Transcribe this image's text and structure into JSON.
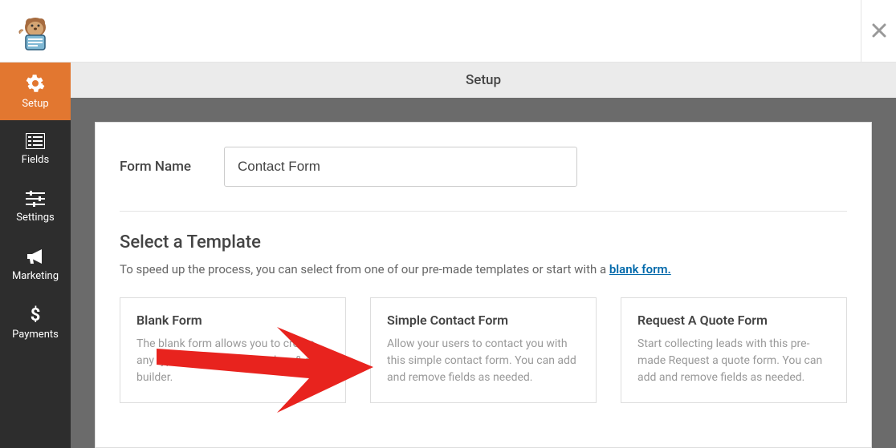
{
  "header": {
    "page_title": "Setup"
  },
  "sidebar": {
    "items": [
      {
        "label": "Setup",
        "icon": "gear"
      },
      {
        "label": "Fields",
        "icon": "list"
      },
      {
        "label": "Settings",
        "icon": "sliders"
      },
      {
        "label": "Marketing",
        "icon": "megaphone"
      },
      {
        "label": "Payments",
        "icon": "dollar"
      }
    ]
  },
  "form_name": {
    "label": "Form Name",
    "value": "Contact Form"
  },
  "template_section": {
    "title": "Select a Template",
    "description_prefix": "To speed up the process, you can select from one of our pre-made templates or start with a ",
    "link_text": "blank form.",
    "templates": [
      {
        "title": "Blank Form",
        "description": "The blank form allows you to create any type of form using our drag & drop builder."
      },
      {
        "title": "Simple Contact Form",
        "description": "Allow your users to contact you with this simple contact form. You can add and remove fields as needed."
      },
      {
        "title": "Request A Quote Form",
        "description": "Start collecting leads with this pre-made Request a quote form. You can add and remove fields as needed."
      }
    ]
  }
}
